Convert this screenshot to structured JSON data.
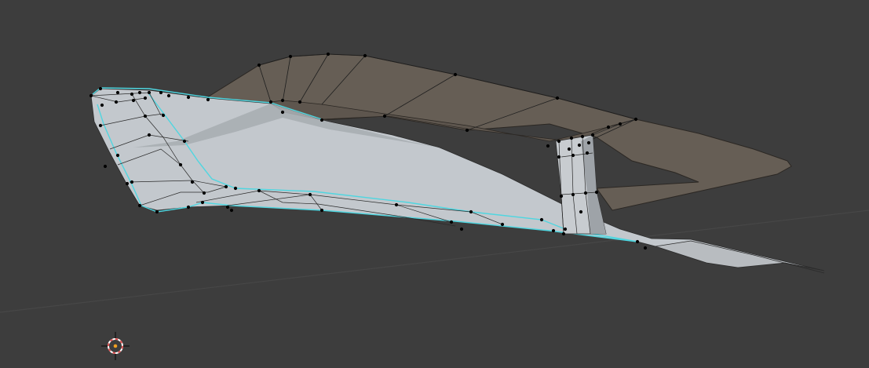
{
  "viewport": {
    "background_color": "#3d3d3d",
    "grid_line_color": "#474747",
    "mesh_face_light_color": "#c3c8cd",
    "mesh_face_dark_color": "#665e55",
    "mesh_edge_color": "#1e1e1e",
    "mesh_vertex_color": "#000000",
    "selection_outline_color": "#4fd6e0",
    "cursor_ring_color": "#e05050",
    "cursor_center_color": "#f0a020"
  },
  "objects": {
    "active_object_icon": "mesh-object-icon",
    "cursor_icon": "3d-cursor-icon"
  }
}
